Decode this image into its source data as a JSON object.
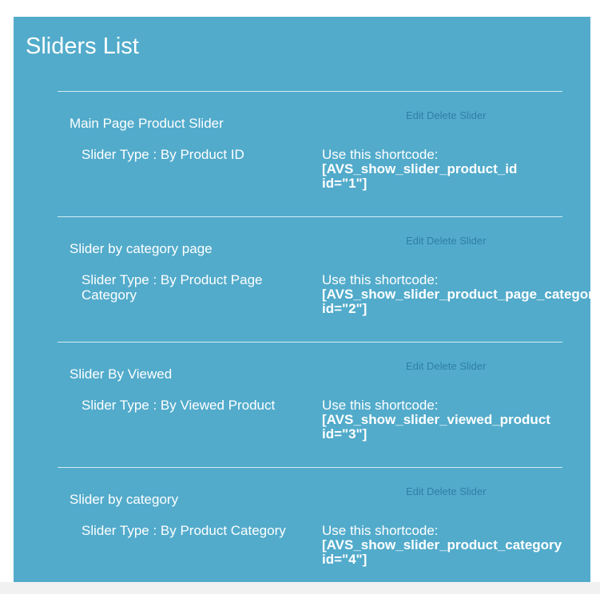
{
  "page": {
    "title": "Sliders List"
  },
  "sliders": [
    {
      "name": "Main Page Product Slider",
      "edit_label": "Edit",
      "delete_label": "Delete",
      "slider_label": "Slider",
      "type_text": "Slider Type : By Product ID",
      "shortcode_label": "Use this shortcode:",
      "shortcode_line1": "[AVS_show_slider_product_id",
      "shortcode_line2": "id=\"1\"]"
    },
    {
      "name": "Slider by category page",
      "edit_label": "Edit",
      "delete_label": "Delete",
      "slider_label": "Slider",
      "type_text": "Slider Type : By Product Page Category",
      "shortcode_label": "Use this shortcode:",
      "shortcode_line1": "[AVS_show_slider_product_page_category",
      "shortcode_line2": "id=\"2\"]"
    },
    {
      "name": "Slider By Viewed",
      "edit_label": "Edit",
      "delete_label": "Delete",
      "slider_label": "Slider",
      "type_text": "Slider Type : By Viewed Product",
      "shortcode_label": "Use this shortcode:",
      "shortcode_line1": "[AVS_show_slider_viewed_product",
      "shortcode_line2": "id=\"3\"]"
    },
    {
      "name": "Slider by category",
      "edit_label": "Edit",
      "delete_label": "Delete",
      "slider_label": "Slider",
      "type_text": "Slider Type : By Product Category",
      "shortcode_label": "Use this shortcode:",
      "shortcode_line1": "[AVS_show_slider_product_category",
      "shortcode_line2": "id=\"4\"]"
    }
  ],
  "colors": {
    "panel_background": "#52abcb",
    "action_link": "#2f7ea6",
    "text": "#ffffff"
  }
}
